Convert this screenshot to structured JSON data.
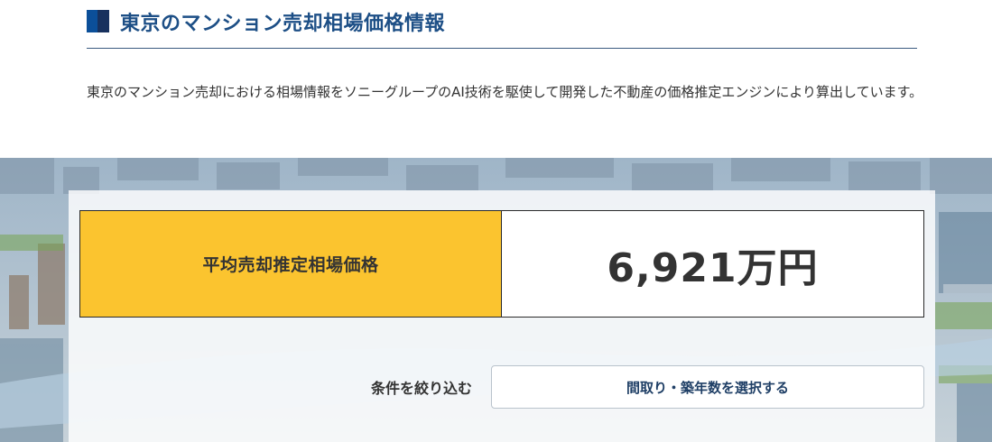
{
  "heading": {
    "title": "東京のマンション売却相場価格情報",
    "mark_colors": [
      "#0b4f99",
      "#17315e"
    ]
  },
  "description": "東京のマンション売却における相場情報をソニーグループのAI技術を駆使して開発した不動産の価格推定エンジンにより算出しています。",
  "price": {
    "label": "平均売却推定相場価格",
    "value": "6,921万円",
    "label_bg": "#fbc42f"
  },
  "filter": {
    "label": "条件を絞り込む",
    "button_label": "間取り・築年数を選択する"
  },
  "colors": {
    "accent": "#1d4f86",
    "heading_rule": "#3a5a80"
  }
}
